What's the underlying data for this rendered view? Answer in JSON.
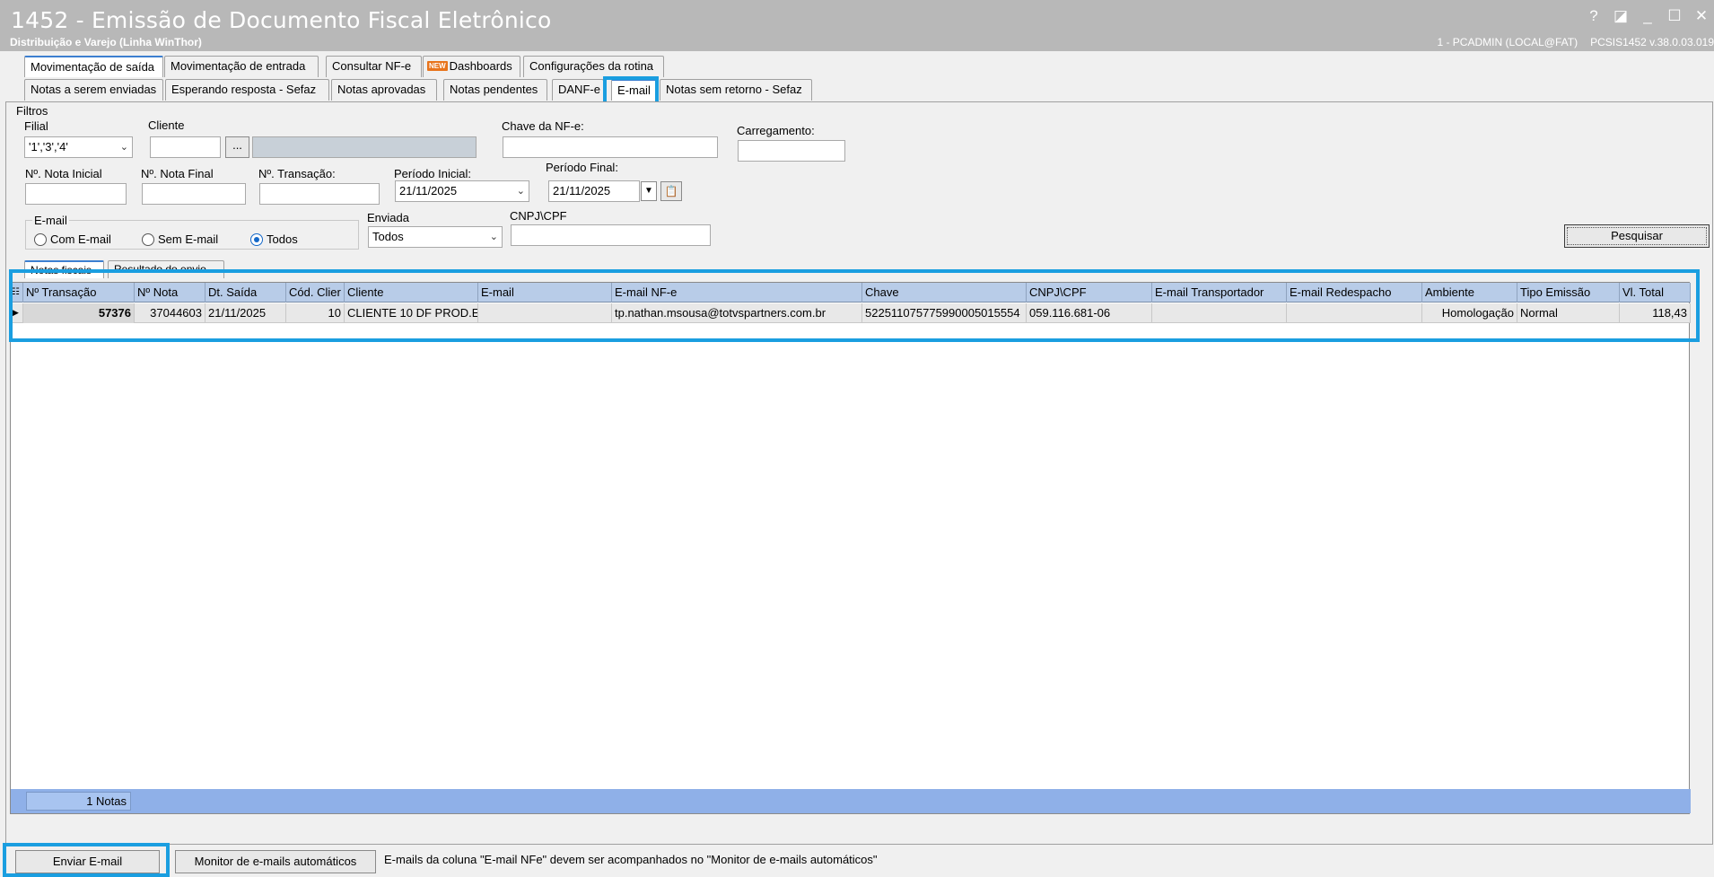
{
  "window": {
    "title": "1452 - Emissão de Documento Fiscal Eletrônico",
    "subtitle": "Distribuição e Varejo (Linha WinThor)",
    "user_info": "1 - PCADMIN (LOCAL@FAT)",
    "version_info": "PCSIS1452  v.38.0.03.019",
    "buttons": [
      "?",
      "◪",
      "_",
      "☐",
      "✕"
    ]
  },
  "main_tabs": [
    {
      "label": "Movimentação de saída",
      "active": true
    },
    {
      "label": "Movimentação de entrada",
      "active": false
    },
    {
      "label": "Consultar NF-e",
      "active": false
    },
    {
      "label": "Dashboards",
      "badge": "NEW",
      "active": false
    },
    {
      "label": "Configurações da rotina",
      "active": false
    }
  ],
  "sub_tabs": [
    {
      "label": "Notas a serem enviadas",
      "active": false
    },
    {
      "label": "Esperando resposta - Sefaz",
      "active": false
    },
    {
      "label": "Notas aprovadas",
      "active": false
    },
    {
      "label": "Notas pendentes",
      "active": false
    },
    {
      "label": "DANF-e",
      "active": false
    },
    {
      "label": "E-mail",
      "active": true
    },
    {
      "label": "Notas sem retorno - Sefaz",
      "active": false
    }
  ],
  "filters": {
    "group_label": "Filtros",
    "filial_label": "Filial",
    "filial_value": "'1','3','4'",
    "cliente_label": "Cliente",
    "cliente_value": "",
    "cliente_button": "...",
    "chave_label": "Chave da NF-e:",
    "chave_value": "",
    "carregamento_label": "Carregamento:",
    "carregamento_value": "",
    "nota_inicial_label": "Nº. Nota Inicial",
    "nota_final_label": "Nº. Nota Final",
    "transacao_label": "Nº. Transação:",
    "periodo_inicial_label": "Período Inicial:",
    "periodo_inicial_value": "21/11/2025",
    "periodo_final_label": "Período Final:",
    "periodo_final_value": "21/11/2025",
    "email_group_label": "E-mail",
    "email_options": [
      {
        "label": "Com E-mail",
        "selected": false
      },
      {
        "label": "Sem E-mail",
        "selected": false
      },
      {
        "label": "Todos",
        "selected": true
      }
    ],
    "enviada_label": "Enviada",
    "enviada_value": "Todos",
    "cnpj_label": "CNPJ\\CPF",
    "cnpj_value": "",
    "search_button": "Pesquisar"
  },
  "inner_tabs": [
    {
      "label": "Notas fiscais",
      "active": true
    },
    {
      "label": "Resultado do envio",
      "active": false
    }
  ],
  "grid": {
    "columns": [
      "Nº Transação",
      "Nº Nota",
      "Dt. Saída",
      "Cód. Clier",
      "Cliente",
      "E-mail",
      "E-mail NF-e",
      "Chave",
      "CNPJ\\CPF",
      "E-mail Transportador",
      "E-mail Redespacho",
      "Ambiente",
      "Tipo Emissão",
      "Vl. Total"
    ],
    "rows": [
      [
        "57376",
        "37044603",
        "21/11/2025",
        "10",
        "CLIENTE 10 DF PROD.E",
        "",
        "tp.nathan.msousa@totvspartners.com.br",
        "522511075775990005015554",
        "059.116.681-06",
        "",
        "",
        "Homologação",
        "Normal",
        "118,43"
      ]
    ],
    "footer_count": "1 Notas"
  },
  "actions": {
    "send_button": "Enviar E-mail",
    "monitor_button": "Monitor de e-mails automáticos",
    "note": "E-mails da coluna \"E-mail NFe\" devem ser acompanhados no \"Monitor de e-mails automáticos\""
  },
  "colors": {
    "highlight": "#1a9ee0",
    "grid_header": "#b8cce8",
    "grid_footer": "#8fb0e8",
    "titlebar": "#b8b8b8"
  }
}
